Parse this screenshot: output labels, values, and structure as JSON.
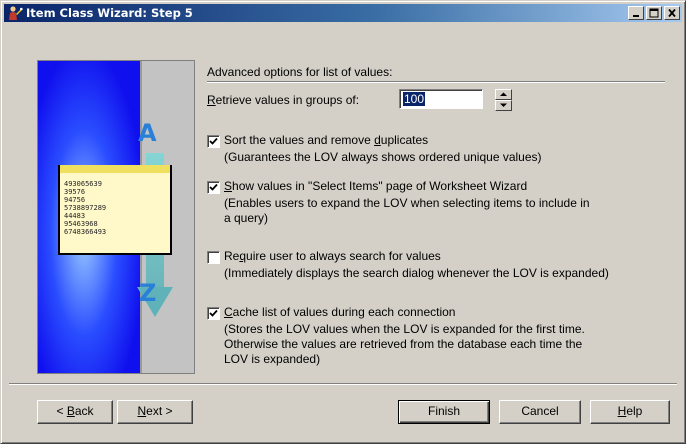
{
  "window": {
    "title": "Item Class Wizard: Step 5",
    "controls": {
      "minimize": "_",
      "maximize": "□",
      "close": "×"
    }
  },
  "illustration": {
    "letters": {
      "top": "A",
      "bottom": "Z"
    },
    "list_values": [
      "493065639",
      "39576",
      "94756",
      "5738897289",
      "44483",
      "95463968",
      "6748366493"
    ]
  },
  "heading": "Advanced options for list of values:",
  "retrieve": {
    "label_pre": "",
    "label_underlined": "R",
    "label_post": "etrieve values in groups of:",
    "value": "100"
  },
  "options": [
    {
      "checked": true,
      "label_pre": "Sort the values and remove ",
      "label_underlined": "d",
      "label_post": "uplicates",
      "desc": [
        "(Guarantees the LOV always shows ordered unique values)"
      ]
    },
    {
      "checked": true,
      "label_pre": "",
      "label_underlined": "S",
      "label_post": "how values in \"Select Items\" page of Worksheet Wizard",
      "desc": [
        "(Enables users to expand the LOV when selecting items to include in",
        "a query)"
      ]
    },
    {
      "checked": false,
      "label_pre": "Re",
      "label_underlined": "q",
      "label_post": "uire user to always search for values",
      "desc": [
        "(Immediately displays the search dialog whenever the LOV is expanded)"
      ]
    },
    {
      "checked": true,
      "label_pre": "",
      "label_underlined": "C",
      "label_post": "ache list of values during each connection",
      "desc": [
        "(Stores the LOV values when the LOV is expanded for the first time.",
        "Otherwise the values are retrieved from the database each time the",
        "LOV is expanded)"
      ]
    }
  ],
  "buttons": {
    "back": {
      "pre": "< ",
      "u": "B",
      "post": "ack"
    },
    "next": {
      "pre": "",
      "u": "N",
      "post": "ext >"
    },
    "finish": "Finish",
    "cancel": "Cancel",
    "help": {
      "pre": "",
      "u": "H",
      "post": "elp"
    }
  }
}
